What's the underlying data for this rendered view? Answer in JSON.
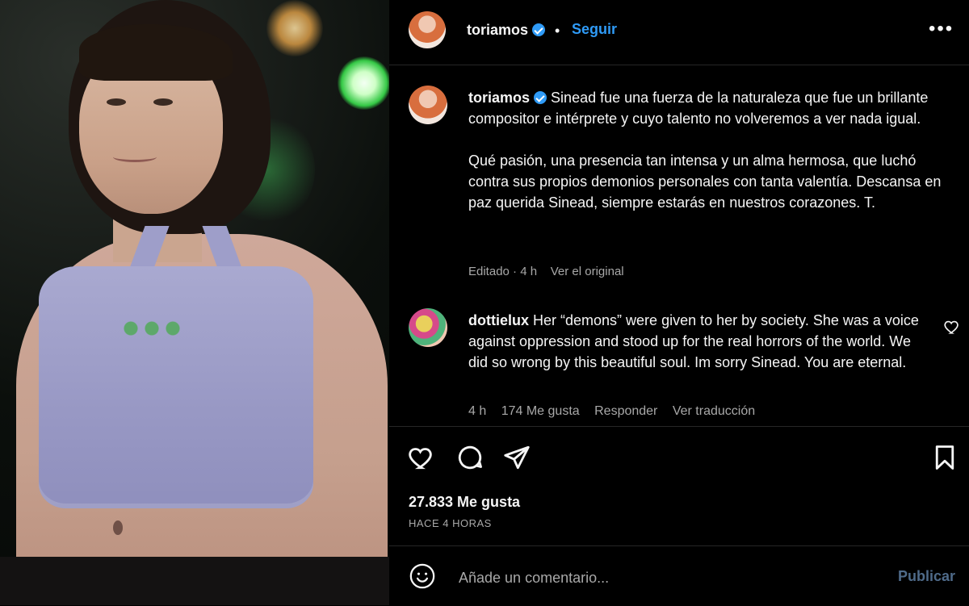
{
  "photo": {
    "alt": "Photo of a woman on stage in a lavender halter crop top"
  },
  "header": {
    "username": "toriamos",
    "separator": "•",
    "follow_label": "Seguir",
    "more_label": "•••"
  },
  "caption": {
    "username": "toriamos",
    "paragraph1": "Sinead fue una fuerza de la naturaleza que fue un brillante compositor e intérprete y cuyo talento no volveremos a ver nada igual.",
    "paragraph2": "Qué pasión, una presencia tan intensa y un alma hermosa, que luchó contra sus propios demonios personales con tanta valentía. Descansa en paz querida Sinead, siempre estarás en nuestros corazones. T.",
    "edited": "Editado · 4 h",
    "see_original": "Ver el original"
  },
  "comment": {
    "username": "dottielux",
    "text": "Her “demons” were given to her by society. She was a voice against oppression and stood up for the real horrors of the world. We did so wrong by this beautiful soul. Im sorry Sinead. You are eternal.",
    "time": "4 h",
    "likes": "174 Me gusta",
    "reply": "Responder",
    "translate": "Ver traducción"
  },
  "actions": {
    "likes": "27.833 Me gusta",
    "posted": "HACE 4 HORAS",
    "icons": [
      "heart-icon",
      "comment-icon",
      "share-icon",
      "bookmark-icon"
    ]
  },
  "add_comment": {
    "placeholder": "Añade un comentario...",
    "post_label": "Publicar"
  },
  "colors": {
    "background": "#000000",
    "text": "#f5f5f5",
    "muted": "#a8a8a8",
    "accent": "#2f9bf7",
    "post_disabled": "#4f6b8a"
  }
}
